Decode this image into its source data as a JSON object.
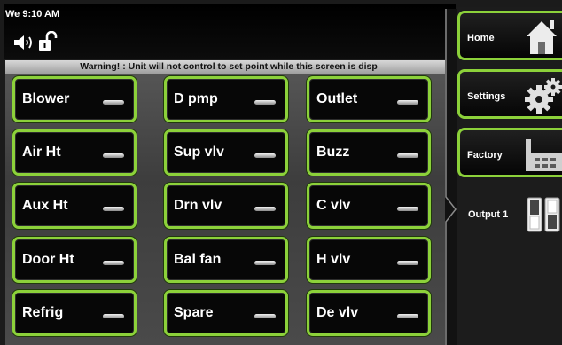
{
  "status": {
    "time": "We 9:10 AM",
    "icons": [
      "speaker-icon",
      "unlocked-padlock-icon"
    ]
  },
  "warning": "Warning! : Unit will not control to set point while this screen is disp",
  "colors": {
    "accent": "#8cd13a",
    "background": "#1b1b1b",
    "button_face": "#070707"
  },
  "outputs": [
    {
      "label": "Blower"
    },
    {
      "label": "D pmp"
    },
    {
      "label": "Outlet"
    },
    {
      "label": "Air Ht"
    },
    {
      "label": "Sup vlv"
    },
    {
      "label": "Buzz"
    },
    {
      "label": "Aux Ht"
    },
    {
      "label": "Drn vlv"
    },
    {
      "label": "C vlv"
    },
    {
      "label": "Door Ht"
    },
    {
      "label": "Bal fan"
    },
    {
      "label": "H vlv"
    },
    {
      "label": "Refrig"
    },
    {
      "label": "Spare"
    },
    {
      "label": "De vlv"
    }
  ],
  "nav": {
    "home": {
      "label": "Home",
      "icon": "house-icon"
    },
    "settings": {
      "label": "Settings",
      "icon": "gears-icon"
    },
    "factory": {
      "label": "Factory",
      "icon": "factory-icon"
    }
  },
  "output_panel": {
    "label": "Output 1",
    "icon": "toggle-switch-icon"
  }
}
